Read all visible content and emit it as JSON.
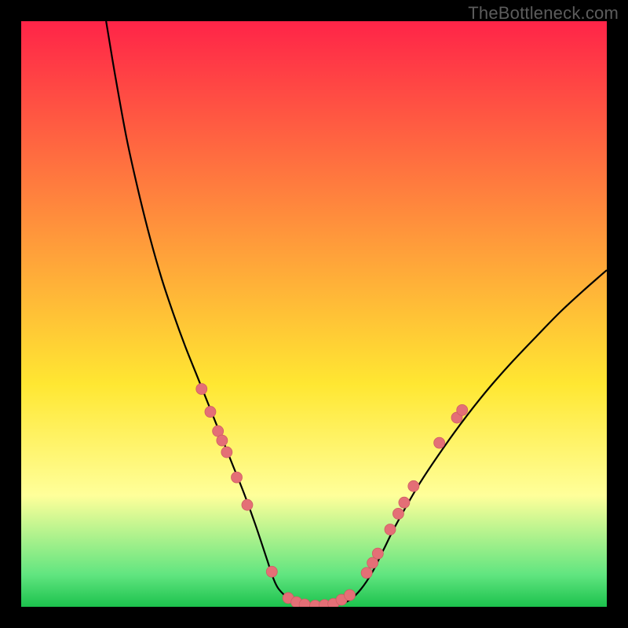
{
  "watermark": "TheBottleneck.com",
  "colors": {
    "gradient_top": "#ff2448",
    "gradient_mid": "#ffe732",
    "gradient_lowlight": "#ffff9a",
    "gradient_band": "#61e580",
    "gradient_bottom": "#1cc24d",
    "frame": "#000000",
    "curve": "#000000",
    "marker_fill": "#e46f76",
    "marker_stroke": "#cf5d63"
  },
  "chart_data": {
    "type": "line",
    "title": "",
    "xlabel": "",
    "ylabel": "",
    "xlim": [
      0,
      100
    ],
    "ylim": [
      0,
      100
    ],
    "series": [
      {
        "name": "curve",
        "x": [
          14.5,
          16,
          18,
          20,
          22,
          24,
          26,
          28,
          30,
          32,
          34,
          36,
          38,
          40,
          42,
          43,
          44,
          46,
          48,
          50,
          52,
          54,
          56,
          58,
          60,
          62,
          64,
          68,
          72,
          76,
          80,
          84,
          88,
          92,
          96,
          100
        ],
        "y": [
          100,
          91,
          80,
          71,
          63,
          56,
          50,
          44.5,
          39.5,
          34.5,
          29.5,
          24.5,
          19.5,
          14,
          8,
          5,
          3,
          1.2,
          0.4,
          0.2,
          0.2,
          0.4,
          1.1,
          3,
          6,
          10,
          14,
          21,
          27,
          32.5,
          37.5,
          42,
          46.2,
          50.3,
          54,
          57.5
        ]
      }
    ],
    "markers": [
      {
        "x": 30.8,
        "y": 37.2
      },
      {
        "x": 32.3,
        "y": 33.3
      },
      {
        "x": 33.6,
        "y": 30.0
      },
      {
        "x": 34.3,
        "y": 28.4
      },
      {
        "x": 35.1,
        "y": 26.4
      },
      {
        "x": 36.8,
        "y": 22.1
      },
      {
        "x": 38.6,
        "y": 17.4
      },
      {
        "x": 42.8,
        "y": 6.0
      },
      {
        "x": 45.6,
        "y": 1.5
      },
      {
        "x": 47.0,
        "y": 0.8
      },
      {
        "x": 48.4,
        "y": 0.4
      },
      {
        "x": 50.2,
        "y": 0.2
      },
      {
        "x": 51.8,
        "y": 0.3
      },
      {
        "x": 53.3,
        "y": 0.5
      },
      {
        "x": 54.7,
        "y": 1.2
      },
      {
        "x": 56.1,
        "y": 2.0
      },
      {
        "x": 59.0,
        "y": 5.8
      },
      {
        "x": 60.0,
        "y": 7.5
      },
      {
        "x": 60.9,
        "y": 9.1
      },
      {
        "x": 63.0,
        "y": 13.2
      },
      {
        "x": 64.4,
        "y": 15.9
      },
      {
        "x": 65.4,
        "y": 17.8
      },
      {
        "x": 67.0,
        "y": 20.6
      },
      {
        "x": 71.4,
        "y": 28.0
      },
      {
        "x": 74.4,
        "y": 32.3
      },
      {
        "x": 75.3,
        "y": 33.6
      }
    ],
    "marker_radius_px": 7
  }
}
